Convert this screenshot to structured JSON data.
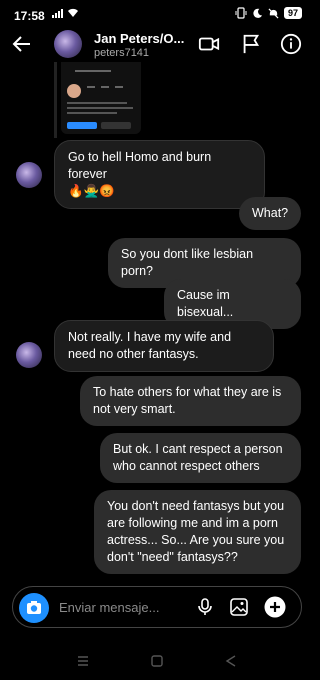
{
  "status_bar": {
    "time": "17:58",
    "battery": "97"
  },
  "header": {
    "name": "Jan Peters/O...",
    "handle": "peters7141"
  },
  "messages": [
    {
      "dir": "in",
      "text": "Go to hell Homo and burn forever",
      "emoji": "🔥🙅‍♂️😡"
    },
    {
      "dir": "out",
      "text": "What?"
    },
    {
      "dir": "out",
      "text": "So you dont like lesbian porn?"
    },
    {
      "dir": "out",
      "text": "Cause im bisexual..."
    },
    {
      "dir": "in",
      "text": "Not really. I have my wife and need no other fantasys."
    },
    {
      "dir": "out",
      "text": "To hate others for what they are is not very smart."
    },
    {
      "dir": "out",
      "text": "But ok. I cant respect a person who cannot respect others"
    },
    {
      "dir": "out",
      "text": "You don't need fantasys but you are following me and im a porn actress... So... Are you sure you don't \"need\" fantasys??"
    }
  ],
  "composer": {
    "placeholder": "Enviar mensaje..."
  },
  "icons": {
    "back": "arrow-left-icon",
    "video": "video-camera-icon",
    "flag": "flag-icon",
    "info": "info-icon",
    "camera": "camera-icon",
    "mic": "microphone-icon",
    "gallery": "gallery-icon",
    "add": "plus-circle-icon"
  },
  "colors": {
    "background": "#000000",
    "incoming_bubble": "#1c1c1c",
    "outgoing_bubble": "#2d2d2d",
    "accent": "#1e90ff"
  }
}
